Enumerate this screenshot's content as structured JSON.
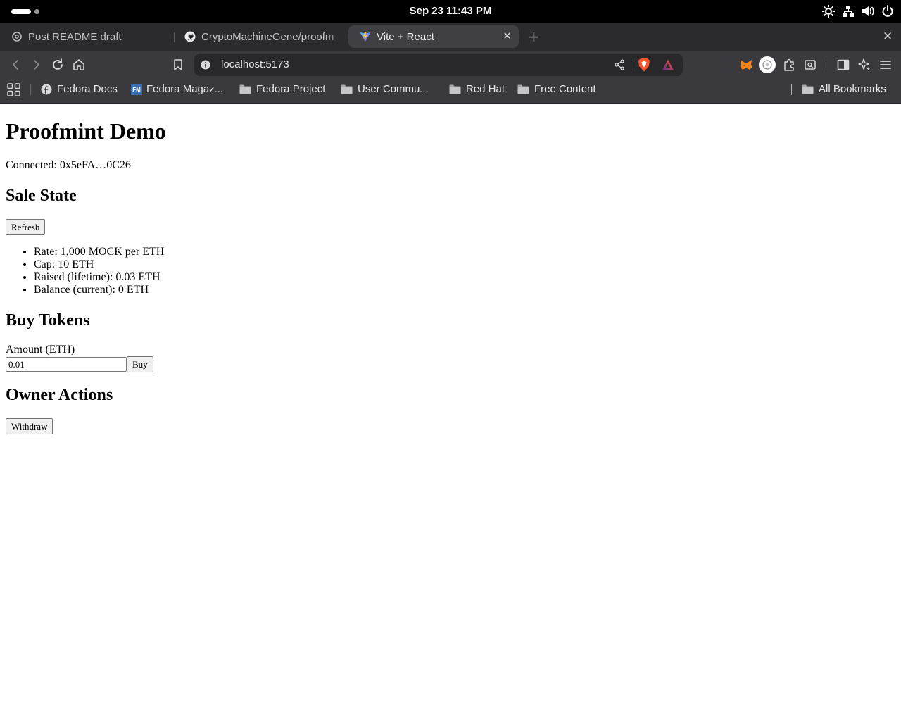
{
  "system": {
    "clock": "Sep 23  11:43 PM",
    "tray_icons": [
      "brightness-icon",
      "network-icon",
      "volume-icon",
      "power-icon"
    ]
  },
  "browser": {
    "tabs": [
      {
        "title": "Post README draft",
        "icon": "openai-icon",
        "active": false
      },
      {
        "title": "CryptoMachineGene/proofm",
        "icon": "github-icon",
        "active": false
      },
      {
        "title": "Vite + React",
        "icon": "vite-icon",
        "active": true
      }
    ],
    "new_tab": "+",
    "window_close": "✕",
    "tab_close": "✕",
    "url": "localhost:5173",
    "bookmarks": [
      {
        "label": "Fedora Docs",
        "icon": "fedora-icon"
      },
      {
        "label": "Fedora Magaz...",
        "icon": "fm-icon"
      },
      {
        "label": "Fedora Project",
        "icon": "folder-icon"
      },
      {
        "label": "User Commu...",
        "icon": "folder-icon"
      },
      {
        "label": "Red Hat",
        "icon": "folder-icon"
      },
      {
        "label": "Free Content",
        "icon": "folder-icon"
      }
    ],
    "all_bookmarks": "All Bookmarks",
    "fm_badge": "FM"
  },
  "page": {
    "title": "Proofmint Demo",
    "connected": "Connected: 0x5eFA…0C26",
    "sale_state": {
      "heading": "Sale State",
      "refresh_label": "Refresh",
      "items": [
        "Rate: 1,000 MOCK per ETH",
        "Cap: 10 ETH",
        "Raised (lifetime): 0.03 ETH",
        "Balance (current): 0 ETH"
      ]
    },
    "buy": {
      "heading": "Buy Tokens",
      "amount_label": "Amount (ETH)",
      "amount_value": "0.01",
      "buy_label": "Buy"
    },
    "owner": {
      "heading": "Owner Actions",
      "withdraw_label": "Withdraw"
    }
  }
}
